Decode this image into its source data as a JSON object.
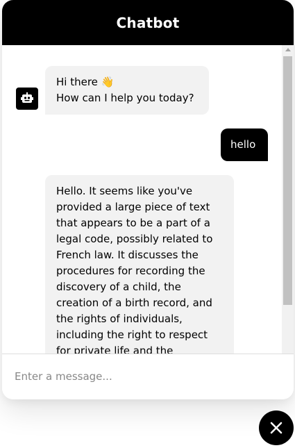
{
  "header": {
    "title": "Chatbot"
  },
  "messages": [
    {
      "role": "bot",
      "text": "Hi there 👋\n How can I help you today?"
    },
    {
      "role": "user",
      "text": "hello"
    },
    {
      "role": "bot",
      "text": "Hello. It seems like you've provided a large piece of text that appears to be a part of a legal code, possibly related to French law. It discusses the procedures for recording the discovery of a child, the creation of a birth record, and the rights of individuals, including the right to respect for private life and the"
    }
  ],
  "input": {
    "placeholder": "Enter a message..."
  },
  "icons": {
    "bot_avatar": "robot-icon",
    "close": "close-icon"
  },
  "colors": {
    "accent": "#000000",
    "bubble_bg": "#f2f2f2"
  }
}
